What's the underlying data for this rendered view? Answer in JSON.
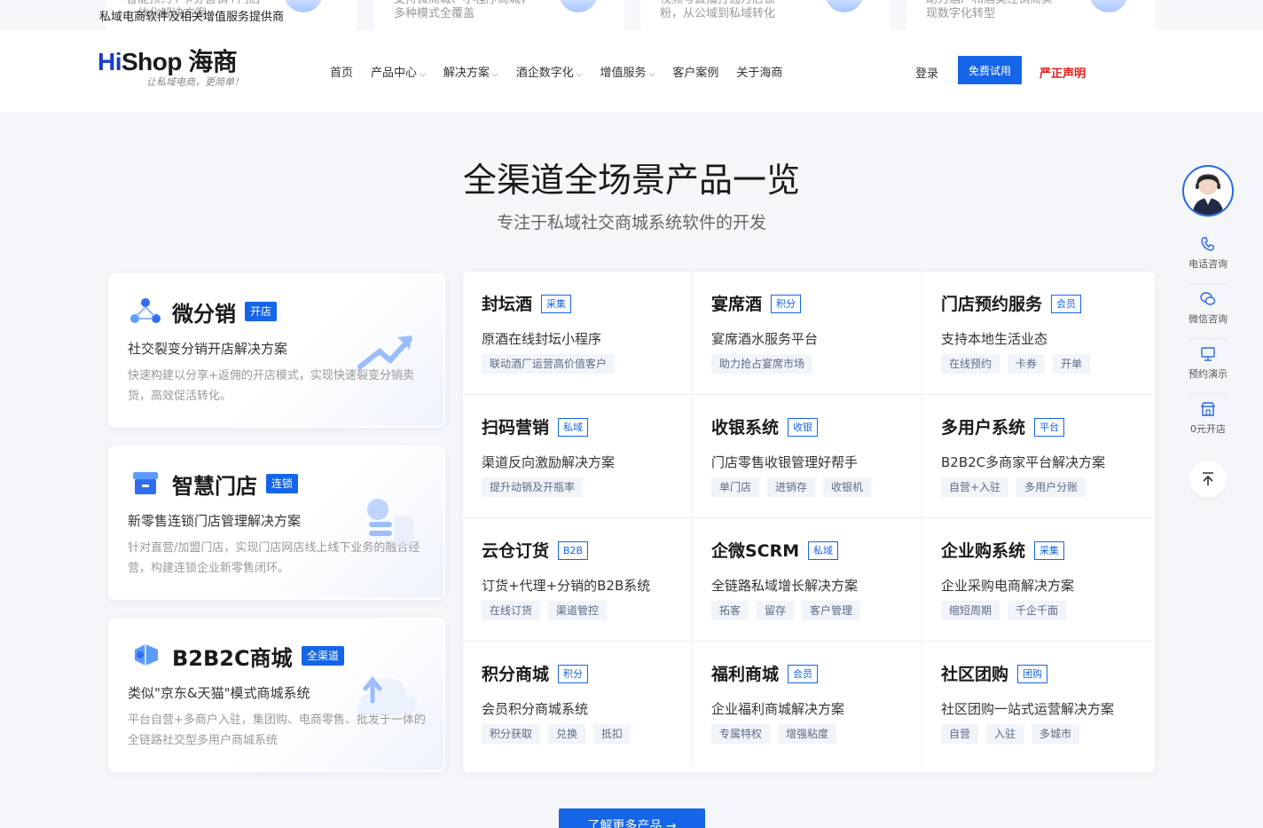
{
  "top_strip": {
    "cards": [
      {
        "line1": "智能预约+卡券营销+门店",
        "line2": "一体化解决方案"
      },
      {
        "line1": "支持微商城、小程序商城，",
        "line2": "多种模式全覆盖"
      },
      {
        "line1": "视频号直播打通万店锁",
        "line2": "粉，从公域到私域转化"
      },
      {
        "line1": "助力酒厂和酒类经销商实",
        "line2": "现数字化转型"
      }
    ]
  },
  "header": {
    "tagline": "私域电商软件及相关增值服务提供商",
    "logo_hi": "Hi",
    "logo_shop": "Shop",
    "logo_cn": "海商",
    "logo_slogan": "让私域电商，更简单！",
    "nav": [
      {
        "label": "首页",
        "caret": false
      },
      {
        "label": "产品中心",
        "caret": true
      },
      {
        "label": "解决方案",
        "caret": true
      },
      {
        "label": "酒企数字化",
        "caret": true
      },
      {
        "label": "增值服务",
        "caret": true
      },
      {
        "label": "客户案例",
        "caret": false
      },
      {
        "label": "关于海商",
        "caret": false
      }
    ],
    "login": "登录",
    "trial": "免费试用",
    "declaration": "严正声明"
  },
  "section": {
    "title": "全渠道全场景产品一览",
    "subtitle": "专注于私域社交商城系统软件的开发"
  },
  "features": [
    {
      "title": "微分销",
      "badge": "开店",
      "subtitle": "社交裂变分销开店解决方案",
      "desc": "快速构建以分享+返佣的开店模式，实现快速裂变分销卖货，高效促活转化。",
      "icon": "distribution-icon"
    },
    {
      "title": "智慧门店",
      "badge": "连锁",
      "subtitle": "新零售连锁门店管理解决方案",
      "desc": "针对直营/加盟门店，实现门店网店线上线下业务的融合经营，构建连锁企业新零售闭环。",
      "icon": "store-icon"
    },
    {
      "title": "B2B2C商城",
      "badge": "全渠道",
      "subtitle": "类似\"京东&天猫\"模式商城系统",
      "desc": "平台自营+多商户入驻，集团购、电商零售、批发于一体的全链路社交型多用户商城系统",
      "icon": "mall-icon"
    }
  ],
  "products": [
    {
      "title": "封坛酒",
      "badge": "采集",
      "subtitle": "原酒在线封坛小程序",
      "tags": [
        "联动酒厂运营高价值客户"
      ]
    },
    {
      "title": "宴席酒",
      "badge": "积分",
      "subtitle": "宴席酒水服务平台",
      "tags": [
        "助力抢占宴席市场"
      ]
    },
    {
      "title": "门店预约服务",
      "badge": "会员",
      "subtitle": "支持本地生活业态",
      "tags": [
        "在线预约",
        "卡券",
        "开单"
      ]
    },
    {
      "title": "扫码营销",
      "badge": "私域",
      "subtitle": "渠道反向激励解决方案",
      "tags": [
        "提升动销及开瓶率"
      ]
    },
    {
      "title": "收银系统",
      "badge": "收银",
      "subtitle": "门店零售收银管理好帮手",
      "tags": [
        "单门店",
        "进销存",
        "收银机"
      ]
    },
    {
      "title": "多用户系统",
      "badge": "平台",
      "subtitle": "B2B2C多商家平台解决方案",
      "tags": [
        "自营+入驻",
        "多用户分账"
      ]
    },
    {
      "title": "云仓订货",
      "badge": "B2B",
      "subtitle": "订货+代理+分销的B2B系统",
      "tags": [
        "在线订货",
        "渠道管控"
      ]
    },
    {
      "title": "企微SCRM",
      "badge": "私域",
      "subtitle": "全链路私域增长解决方案",
      "tags": [
        "拓客",
        "留存",
        "客户管理"
      ]
    },
    {
      "title": "企业购系统",
      "badge": "采集",
      "subtitle": "企业采购电商解决方案",
      "tags": [
        "缩短周期",
        "千企千面"
      ]
    },
    {
      "title": "积分商城",
      "badge": "积分",
      "subtitle": "会员积分商城系统",
      "tags": [
        "积分获取",
        "兑换",
        "抵扣"
      ]
    },
    {
      "title": "福利商城",
      "badge": "会员",
      "subtitle": "企业福利商城解决方案",
      "tags": [
        "专属特权",
        "增强粘度"
      ]
    },
    {
      "title": "社区团购",
      "badge": "团购",
      "subtitle": "社区团购一站式运营解决方案",
      "tags": [
        "自营",
        "入驻",
        "多城市"
      ]
    }
  ],
  "sidebar": {
    "items": [
      {
        "label": "电话咨询",
        "icon": "phone-icon"
      },
      {
        "label": "微信咨询",
        "icon": "wechat-icon"
      },
      {
        "label": "预约演示",
        "icon": "monitor-icon"
      },
      {
        "label": "0元开店",
        "icon": "shop-icon"
      }
    ],
    "back_top_icon": "back-to-top-icon"
  },
  "more_button": "了解更多产品 →",
  "colors": {
    "brand": "#1565e9",
    "alert": "#e0201c"
  }
}
